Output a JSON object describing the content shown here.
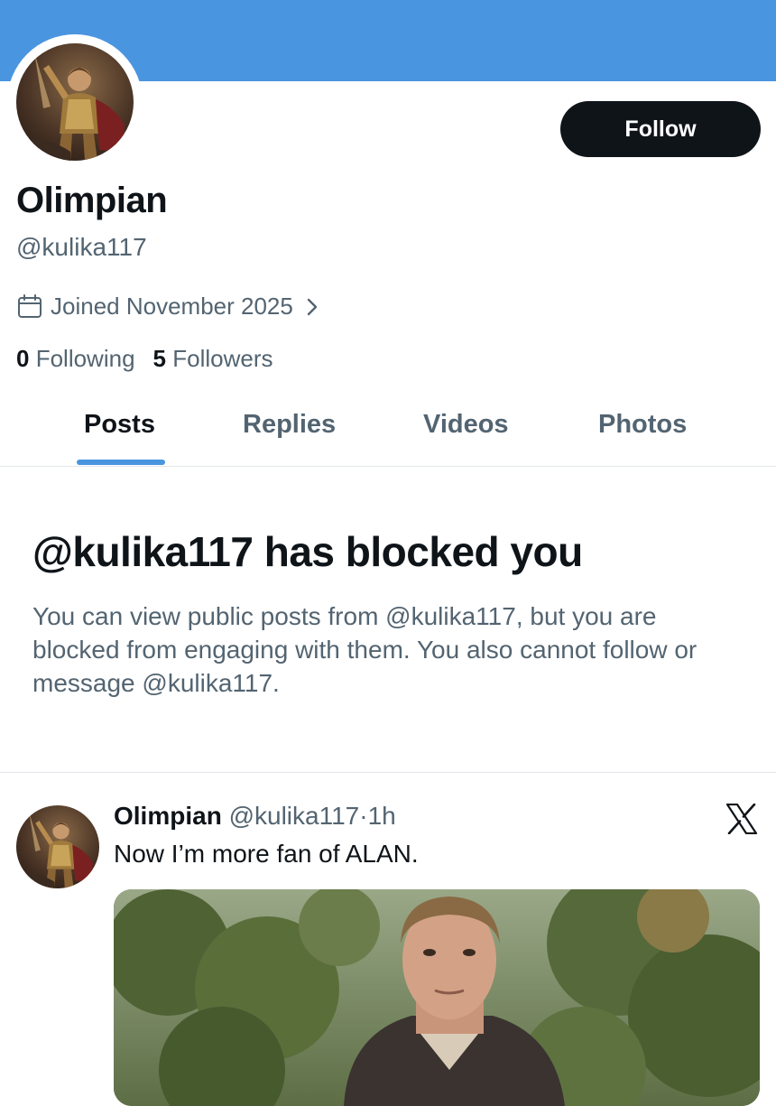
{
  "profile": {
    "display_name": "Olimpian",
    "handle": "@kulika117",
    "joined": "Joined November 2025",
    "following_count": "0",
    "following_label": "Following",
    "followers_count": "5",
    "followers_label": "Followers",
    "follow_button": "Follow"
  },
  "tabs": [
    {
      "label": "Posts",
      "active": true
    },
    {
      "label": "Replies",
      "active": false
    },
    {
      "label": "Videos",
      "active": false
    },
    {
      "label": "Photos",
      "active": false
    }
  ],
  "blocked": {
    "title": "@kulika117 has blocked you",
    "body": "You can view public posts from @kulika117, but you are blocked from engaging with them. You also cannot follow or message @kulika117."
  },
  "post": {
    "author_name": "Olimpian",
    "author_handle": "@kulika117",
    "separator": "·",
    "time": "1h",
    "text": "Now I’m more fan of ALAN.",
    "source_icon": "x-logo-icon"
  },
  "colors": {
    "banner": "#4a95e0",
    "accent": "#4a95e0",
    "follow_button_bg": "#0f1419",
    "secondary_text": "#536471"
  }
}
